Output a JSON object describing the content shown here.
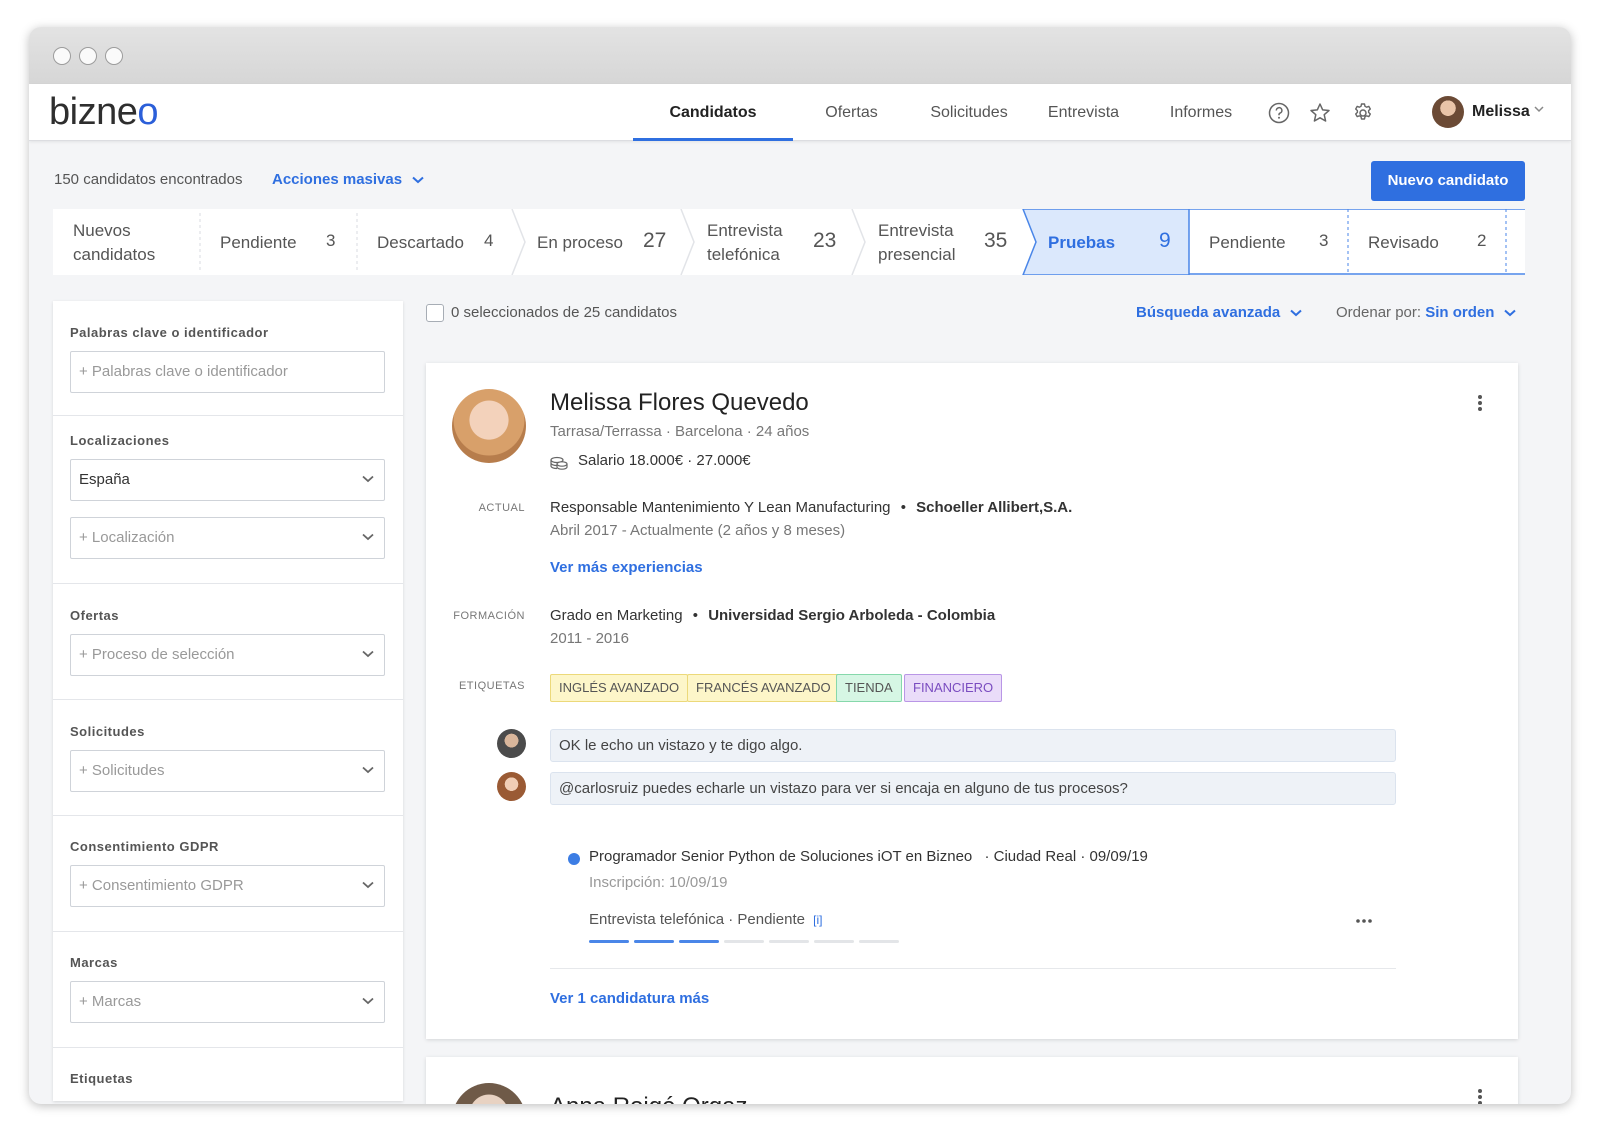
{
  "app": {
    "logo_text": "bizne",
    "logo_o": "o"
  },
  "nav": {
    "items": [
      {
        "label": "Candidatos",
        "active": true
      },
      {
        "label": "Ofertas"
      },
      {
        "label": "Solicitudes"
      },
      {
        "label": "Entrevista"
      },
      {
        "label": "Informes"
      }
    ],
    "icons": [
      "help-icon",
      "star-icon",
      "gear-icon"
    ],
    "user": {
      "name": "Melissa"
    }
  },
  "toolbar": {
    "found_text": "150 candidatos encontrados",
    "bulk_actions_label": "Acciones masivas",
    "new_candidate_label": "Nuevo candidato"
  },
  "pipeline": {
    "stages": [
      {
        "label_1": "Nuevos",
        "label_2": "candidatos",
        "count": ""
      },
      {
        "label_1": "Pendiente",
        "label_2": "",
        "count": "3"
      },
      {
        "label_1": "Descartado",
        "label_2": "",
        "count": "4"
      },
      {
        "label_1": "En proceso",
        "label_2": "",
        "count": "27"
      },
      {
        "label_1": "Entrevista",
        "label_2": "telefónica",
        "count": "23"
      },
      {
        "label_1": "Entrevista",
        "label_2": "presencial",
        "count": "35"
      },
      {
        "label_1": "Pruebas",
        "label_2": "",
        "count": "9",
        "active": true
      },
      {
        "label_1": "Pendiente",
        "label_2": "",
        "count": "3"
      },
      {
        "label_1": "Revisado",
        "label_2": "",
        "count": "2"
      }
    ],
    "active_color": "#dbe8fc"
  },
  "filters": {
    "keywords": {
      "label": "Palabras clave o identificador",
      "placeholder": "+ Palabras clave o identificador"
    },
    "locations": {
      "label": "Localizaciones",
      "value": "España",
      "placeholder": "+ Localización"
    },
    "offers": {
      "label": "Ofertas",
      "placeholder": "+ Proceso de selección"
    },
    "requests": {
      "label": "Solicitudes",
      "placeholder": "+ Solicitudes"
    },
    "gdpr": {
      "label": "Consentimiento GDPR",
      "placeholder": "+ Consentimiento GDPR"
    },
    "brands": {
      "label": "Marcas",
      "placeholder": "+ Marcas"
    },
    "tags": {
      "label": "Etiquetas"
    }
  },
  "list": {
    "selected_text": "0 seleccionados de 25 candidatos",
    "advanced_search_label": "Búsqueda avanzada",
    "order_label": "Ordenar por:",
    "order_value": "Sin orden"
  },
  "candidate": {
    "name": "Melissa Flores Quevedo",
    "location": "Tarrasa/Terrassa · Barcelona · 24 años",
    "salary": "Salario 18.000€ · 27.000€",
    "current_label": "ACTUAL",
    "current_role": "Responsable Mantenimiento Y Lean Manufacturing",
    "current_company": "Schoeller Allibert,S.A.",
    "current_period": "Abril 2017 - Actualmente (2 años y 8 meses)",
    "more_experience": "Ver más experiencias",
    "education_label": "FORMACIÓN",
    "education_degree": "Grado en Marketing",
    "education_school": "Universidad Sergio Arboleda - Colombia",
    "education_period": "2011 - 2016",
    "tags_label": "ETIQUETAS",
    "tags": [
      {
        "text": "INGLÉS AVANZADO",
        "bg": "#fdf6c9",
        "border": "#ecd97a"
      },
      {
        "text": "FRANCÉS AVANZADO",
        "bg": "#fdf6c9",
        "border": "#ecd97a"
      },
      {
        "text": "TIENDA",
        "bg": "#d6f6e4",
        "border": "#86d8ab"
      },
      {
        "text": "FINANCIERO",
        "bg": "#eadcf9",
        "border": "#b996e6"
      }
    ],
    "comments": [
      {
        "text": "OK le echo un vistazo y te digo algo."
      },
      {
        "text": "@carlosruiz puedes echarle un vistazo para ver si encaja en alguno de tus procesos?"
      }
    ],
    "application": {
      "title": "Programador Senior Python de Soluciones iOT en Bizneo",
      "meta": "· Ciudad Real · 09/09/19",
      "registered": "Inscripción: 10/09/19",
      "stage": "Entrevista telefónica · Pendiente",
      "info": "[i]",
      "progress_done": 3,
      "progress_total": 7
    },
    "more_applications": "Ver 1 candidatura más"
  },
  "candidate2": {
    "name": "Anna Roigé Orgaz"
  }
}
